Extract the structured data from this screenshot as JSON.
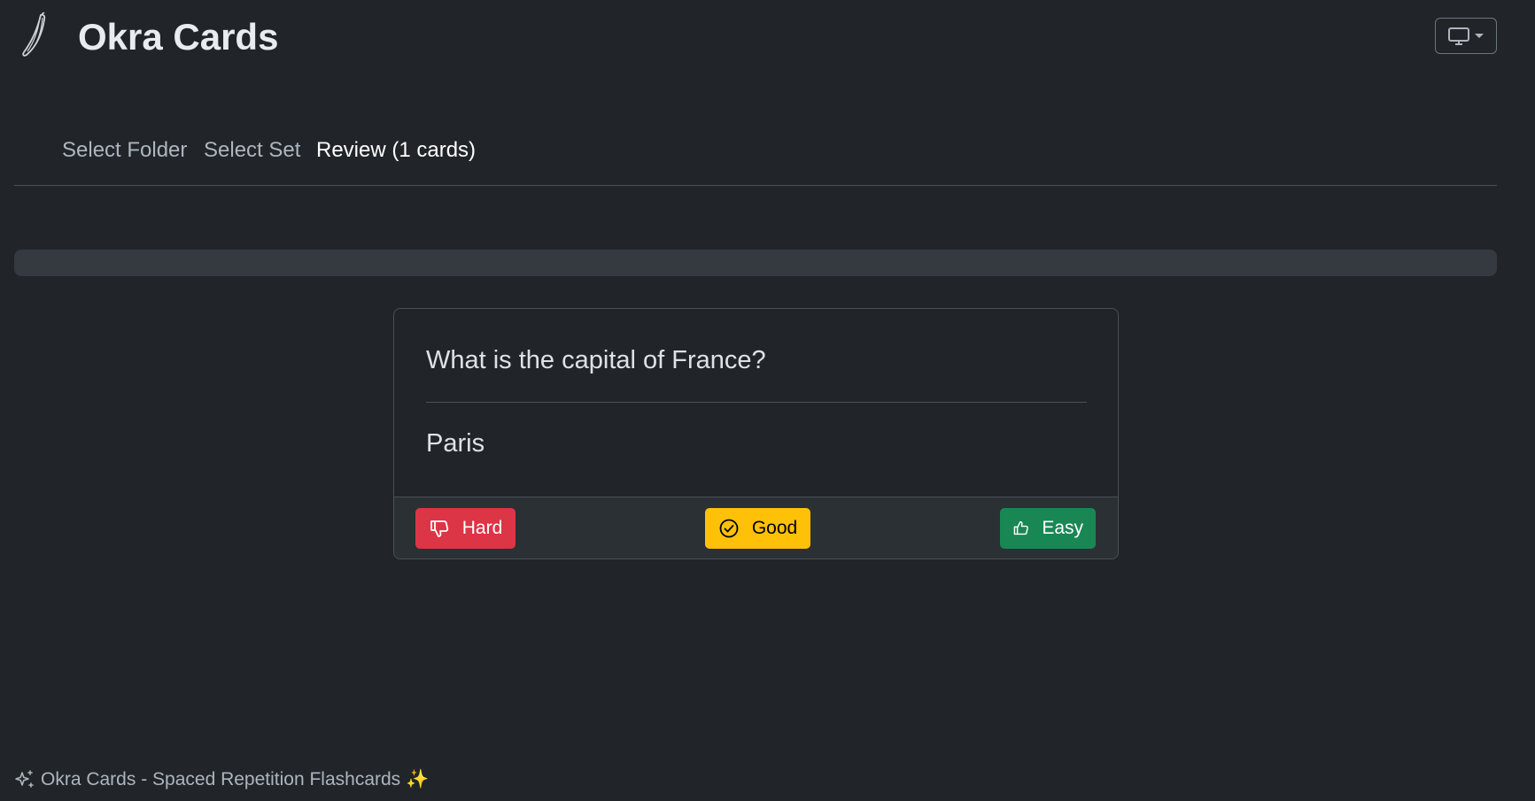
{
  "app": {
    "title": "Okra Cards"
  },
  "theme_toggle": {
    "icon": "monitor-icon",
    "caret_icon": "caret-down-icon"
  },
  "nav": {
    "items": [
      {
        "label": "Select Folder",
        "state": "muted"
      },
      {
        "label": "Select Set",
        "state": "muted"
      },
      {
        "label": "Review (1 cards)",
        "state": "active"
      }
    ]
  },
  "progress": {
    "value_percent": 0
  },
  "card": {
    "question": "What is the capital of France?",
    "answer": "Paris",
    "buttons": {
      "hard": {
        "label": "Hard",
        "icon": "thumbs-down-icon",
        "color": "#dc3545"
      },
      "good": {
        "label": "Good",
        "icon": "check-circle-icon",
        "color": "#ffc107"
      },
      "easy": {
        "label": "Easy",
        "icon": "thumbs-up-icon",
        "color": "#198754"
      }
    }
  },
  "footer": {
    "text": "Okra Cards - Spaced Repetition Flashcards",
    "left_icon": "sparkles-icon",
    "right_emoji": "✨"
  },
  "colors": {
    "background": "#212529",
    "border": "#495057",
    "text": "#dee2e6"
  }
}
